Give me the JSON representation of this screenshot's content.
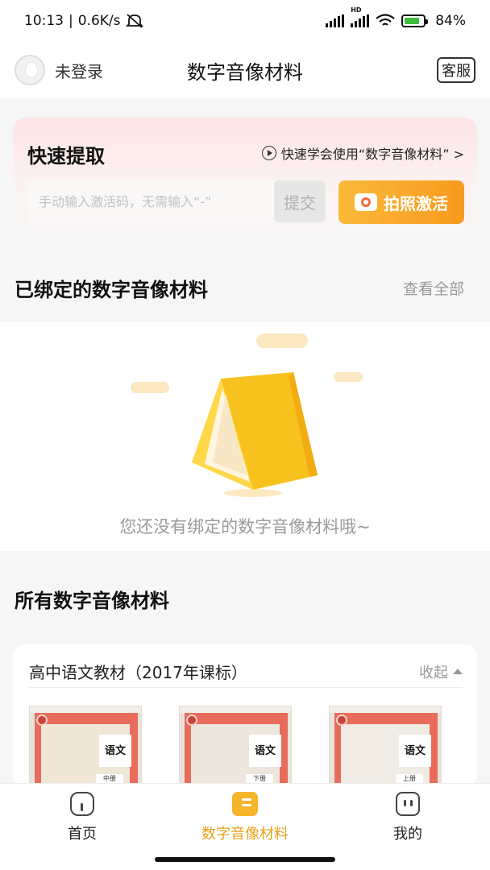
{
  "status_bar": {
    "time": "10:13",
    "speed": "0.6K/s",
    "hd": "HD",
    "battery": "84%"
  },
  "header": {
    "login_status": "未登录",
    "title": "数字音像材料",
    "service_button": "客服"
  },
  "quick_extract": {
    "title": "快速提取",
    "help_link": "快速学会使用“数字音像材料” >",
    "input_placeholder": "手动输入激活码，无需输入“-”",
    "submit_label": "提交",
    "photo_activate_label": "拍照激活"
  },
  "bound_section": {
    "title": "已绑定的数字音像材料",
    "view_all": "查看全部",
    "empty_message": "您还没有绑定的数字音像材料哦~"
  },
  "all_materials": {
    "title": "所有数字音像材料",
    "group_name": "高中语文教材（2017年课标）",
    "collapse_label": "收起",
    "books": [
      {
        "cover_title": "语文",
        "volume": "中册"
      },
      {
        "cover_title": "语文",
        "volume": "下册"
      },
      {
        "cover_title": "语文",
        "volume": "上册"
      }
    ]
  },
  "bottom_nav": {
    "items": [
      {
        "label": "首页",
        "icon": "home-icon"
      },
      {
        "label": "数字音像材料",
        "icon": "book-icon"
      },
      {
        "label": "我的",
        "icon": "profile-icon"
      }
    ],
    "active_index": 1,
    "accent_color": "#e8a21c"
  }
}
